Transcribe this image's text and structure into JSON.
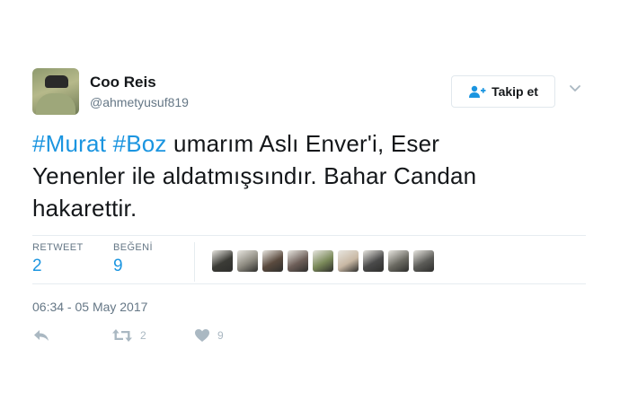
{
  "user": {
    "name": "Coo Reis",
    "handle": "@ahmetyusuf819"
  },
  "follow_button": {
    "label": "Takip et",
    "icon": "follow-person-icon"
  },
  "menu": {
    "icon": "chevron-down-icon"
  },
  "tweet": {
    "hashtag1": "#Murat",
    "hashtag2": "#Boz",
    "line1_rest": " umarım Aslı Enver'i, Eser",
    "line2": "Yenenler ile aldatmışsındır. Bahar Candan",
    "line3": "hakarettir."
  },
  "stats": {
    "retweet_label": "RETWEET",
    "retweet_count": "2",
    "like_label": "BEĞENİ",
    "like_count": "9"
  },
  "likers": [
    "#3b3b36",
    "#8d8a80",
    "#5a4a3e",
    "#6e5f59",
    "#7b8a5a",
    "#c8b8a4",
    "#4a4a4a",
    "#6b6a62",
    "#5c5c58"
  ],
  "timestamp": "06:34 - 05 May 2017",
  "actions": {
    "reply_icon": "reply-icon",
    "retweet_icon": "retweet-icon",
    "retweet_count": "2",
    "like_icon": "heart-icon",
    "like_count": "9"
  },
  "colors": {
    "link": "#1b95e0",
    "muted": "#657786",
    "action_grey": "#aab8c2"
  }
}
